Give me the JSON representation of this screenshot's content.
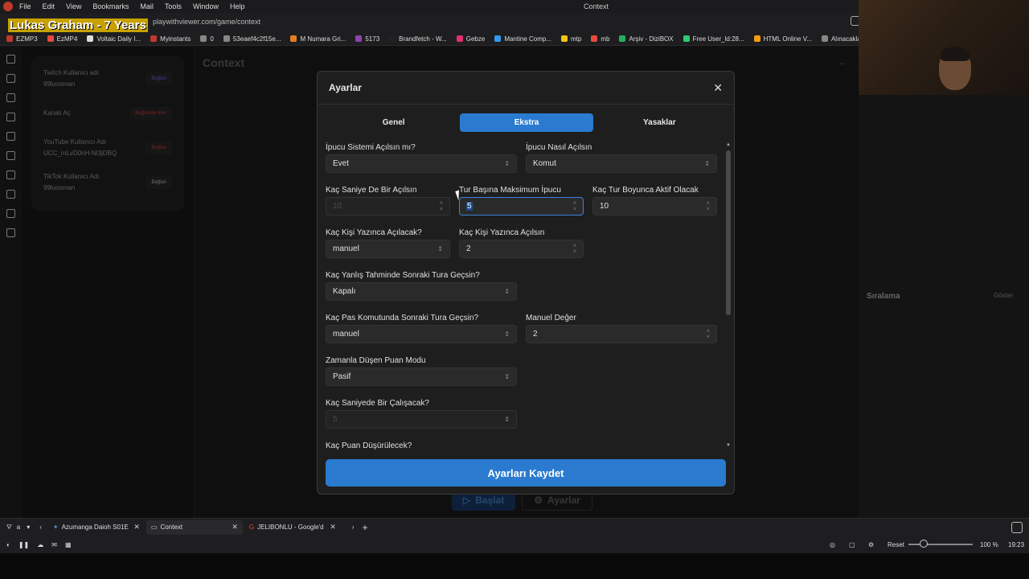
{
  "menubar": {
    "items": [
      "File",
      "Edit",
      "View",
      "Bookmarks",
      "Mail",
      "Tools",
      "Window",
      "Help"
    ],
    "window_title": "Context"
  },
  "overlay_song": "Lukas Graham - 7 Years",
  "address": {
    "url": "playwithviewer.com/game/context"
  },
  "bookmarks": [
    {
      "label": "EZMP3",
      "color": "#c0392b"
    },
    {
      "label": "EzMP4",
      "color": "#e74c3c"
    },
    {
      "label": "Voltaic Daily I...",
      "color": "#ddd"
    },
    {
      "label": "Myinstants",
      "color": "#c0392b"
    },
    {
      "label": "0",
      "color": "#888"
    },
    {
      "label": "53eaef4c2f15e...",
      "color": "#888"
    },
    {
      "label": "M Numara Gri...",
      "color": "#e67e22"
    },
    {
      "label": "5173",
      "color": "#8e44ad"
    },
    {
      "label": "Brandfetch - W...",
      "color": "#222"
    },
    {
      "label": "Gebze",
      "color": "#e1306c"
    },
    {
      "label": "Mantine Comp...",
      "color": "#339af0"
    },
    {
      "label": "mtp",
      "color": "#f1c40f"
    },
    {
      "label": "mb",
      "color": "#e74c3c"
    },
    {
      "label": "Arşiv - DiziBOX",
      "color": "#27ae60"
    },
    {
      "label": "Free User_ld:28...",
      "color": "#2ecc71"
    },
    {
      "label": "HTML Online V...",
      "color": "#f39c12"
    },
    {
      "label": "Alınacaklar",
      "color": "#888"
    }
  ],
  "accounts": [
    {
      "label": "Twitch Kullanıcı adı",
      "value": "99luosman",
      "button": "Bağlan",
      "btn_color": "#6a4fc8"
    },
    {
      "label": "Kanalı Aç",
      "value": "",
      "button": "Bağlantıyı Kes",
      "btn_color": "#b03a3a"
    },
    {
      "label": "YouTube Kullanıcı Adı",
      "value": "UCC_mLvD0nH-Nl3jDBQ",
      "button": "Bağlan",
      "btn_color": "#b03a3a"
    },
    {
      "label": "TikTok Kullanıcı Adı",
      "value": "99luosman",
      "button": "Bağlan",
      "btn_color": "#aaa"
    }
  ],
  "main": {
    "title": "Context",
    "start_label": "Başlat",
    "settings_label": "Ayarlar"
  },
  "right": {
    "ranking_label": "Sıralama",
    "show_label": "Göster"
  },
  "modal": {
    "title": "Ayarlar",
    "tabs": [
      "Genel",
      "Ekstra",
      "Yasaklar"
    ],
    "active_tab": "Ekstra",
    "fields": {
      "ipucu_sistemi": {
        "label": "İpucu Sistemi Açılsın mı?",
        "value": "Evet"
      },
      "ipucu_nasil": {
        "label": "İpucu Nasıl Açılsın",
        "value": "Komut"
      },
      "kac_saniye": {
        "label": "Kaç Saniye De Bir Açılsın",
        "value": "10"
      },
      "tur_basina": {
        "label": "Tur Başına Maksimum İpucu",
        "value": "5"
      },
      "kac_tur": {
        "label": "Kaç Tur Boyunca Aktif Olacak",
        "value": "10"
      },
      "kac_kisi_yazinca": {
        "label": "Kaç Kişi Yazınca Açılacak?",
        "value": "manuel"
      },
      "kac_kisi_acilsin": {
        "label": "Kaç Kişi Yazınca Açılsın",
        "value": "2"
      },
      "yanlis_tahmin": {
        "label": "Kaç Yanlış Tahminde Sonraki Tura Geçsin?",
        "value": "Kapalı"
      },
      "pas_komutu": {
        "label": "Kaç Pas Komutunda Sonraki Tura Geçsin?",
        "value": "manuel"
      },
      "manuel_deger": {
        "label": "Manuel Değer",
        "value": "2"
      },
      "puan_modu": {
        "label": "Zamanla Düşen Puan Modu",
        "value": "Pasif"
      },
      "saniyede_calis": {
        "label": "Kaç Saniyede Bir Çalışacak?",
        "value": "5"
      },
      "puan_dusurulecek": {
        "label": "Kaç Puan Düşürülecek?",
        "value": ""
      }
    },
    "save_label": "Ayarları Kaydet"
  },
  "tabbar": {
    "tabs": [
      {
        "label": "Azumanga Daioh S01E",
        "active": false
      },
      {
        "label": "Context",
        "active": true
      },
      {
        "label": "JELIBONLU - Google'd",
        "active": false
      }
    ],
    "workspace": "a"
  },
  "statusbar": {
    "reset_label": "Reset",
    "zoom": "100 %",
    "time": "19:23"
  }
}
